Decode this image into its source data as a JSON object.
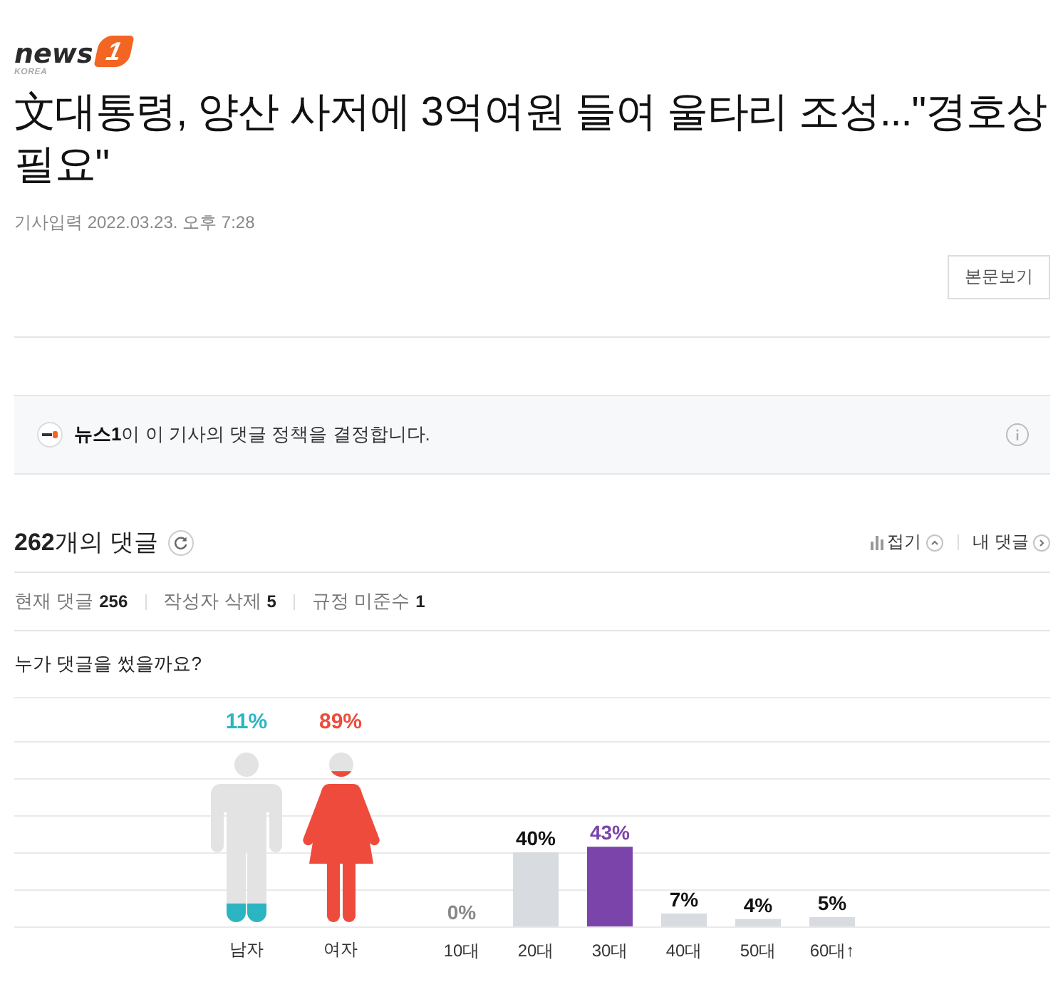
{
  "logo": {
    "wordmark": "news",
    "badge": "1",
    "subtitle": "KOREA"
  },
  "article": {
    "title": "文대통령, 양산 사저에 3억여원 들여 울타리 조성...\"경호상 필요\"",
    "published": "기사입력 2022.03.23. 오후 7:28",
    "view_body_button": "본문보기"
  },
  "policy_notice": {
    "text": "**뉴스1**이 이 기사의 댓글 정책을 결정합니다."
  },
  "comments": {
    "heading": "**262**개의 댓글",
    "collapse_label": "접기",
    "stats_expanded": true,
    "my_comments_link": "내 댓글"
  },
  "stats": [
    {
      "label": "현재 댓글",
      "count": "256"
    },
    {
      "label": "작성자 삭제",
      "count": "5"
    },
    {
      "label": "규정 미준수",
      "count": "1"
    }
  ],
  "demographics": {
    "question": "누가 댓글을 썼을까요?",
    "gender": [
      {
        "kind": "male",
        "label": "남자",
        "percent": "11%",
        "level": 0.11,
        "color": "#2bb5c2"
      },
      {
        "kind": "female",
        "label": "여자",
        "percent": "89%",
        "level": 0.89,
        "color": "#ef4b3c"
      }
    ],
    "age": {
      "chart_data": {
        "type": "bar",
        "categories": [
          "10대",
          "20대",
          "30대",
          "40대",
          "50대",
          "60대↑"
        ],
        "values": [
          0,
          40,
          43,
          7,
          4,
          5
        ],
        "value_labels": [
          "0%",
          "40%",
          "43%",
          "7%",
          "4%",
          "5%"
        ]
      }
    }
  }
}
